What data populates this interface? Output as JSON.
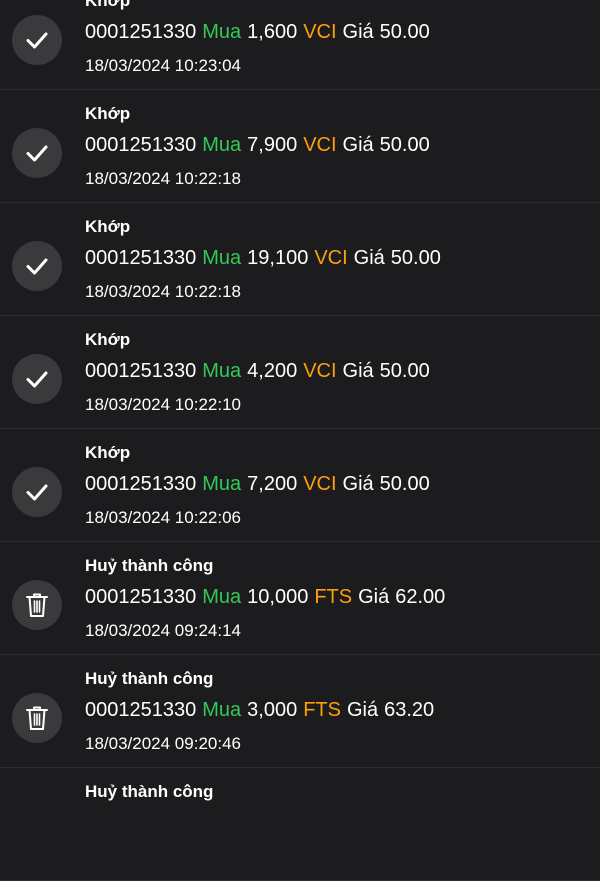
{
  "orders": [
    {
      "status": "Khớp",
      "account": "0001251330",
      "side": "Mua",
      "qty": "1,600",
      "symbol": "VCI",
      "price_label": "Giá",
      "price": "50.00",
      "time": "18/03/2024 10:23:04",
      "icon": "check-icon"
    },
    {
      "status": "Khớp",
      "account": "0001251330",
      "side": "Mua",
      "qty": "7,900",
      "symbol": "VCI",
      "price_label": "Giá",
      "price": "50.00",
      "time": "18/03/2024 10:22:18",
      "icon": "check-icon"
    },
    {
      "status": "Khớp",
      "account": "0001251330",
      "side": "Mua",
      "qty": "19,100",
      "symbol": "VCI",
      "price_label": "Giá",
      "price": "50.00",
      "time": "18/03/2024 10:22:18",
      "icon": "check-icon"
    },
    {
      "status": "Khớp",
      "account": "0001251330",
      "side": "Mua",
      "qty": "4,200",
      "symbol": "VCI",
      "price_label": "Giá",
      "price": "50.00",
      "time": "18/03/2024 10:22:10",
      "icon": "check-icon"
    },
    {
      "status": "Khớp",
      "account": "0001251330",
      "side": "Mua",
      "qty": "7,200",
      "symbol": "VCI",
      "price_label": "Giá",
      "price": "50.00",
      "time": "18/03/2024 10:22:06",
      "icon": "check-icon"
    },
    {
      "status": "Huỷ thành công",
      "account": "0001251330",
      "side": "Mua",
      "qty": "10,000",
      "symbol": "FTS",
      "price_label": "Giá",
      "price": "62.00",
      "time": "18/03/2024 09:24:14",
      "icon": "trash-icon"
    },
    {
      "status": "Huỷ thành công",
      "account": "0001251330",
      "side": "Mua",
      "qty": "3,000",
      "symbol": "FTS",
      "price_label": "Giá",
      "price": "63.20",
      "time": "18/03/2024 09:20:46",
      "icon": "trash-icon"
    },
    {
      "status": "Huỷ thành công",
      "account": "",
      "side": "",
      "qty": "",
      "symbol": "",
      "price_label": "",
      "price": "",
      "time": "",
      "icon": ""
    }
  ],
  "colors": {
    "background": "#1c1c1e",
    "buy": "#34c759",
    "symbol": "#ff9f0a",
    "icon_bg": "#3a3a3c"
  }
}
